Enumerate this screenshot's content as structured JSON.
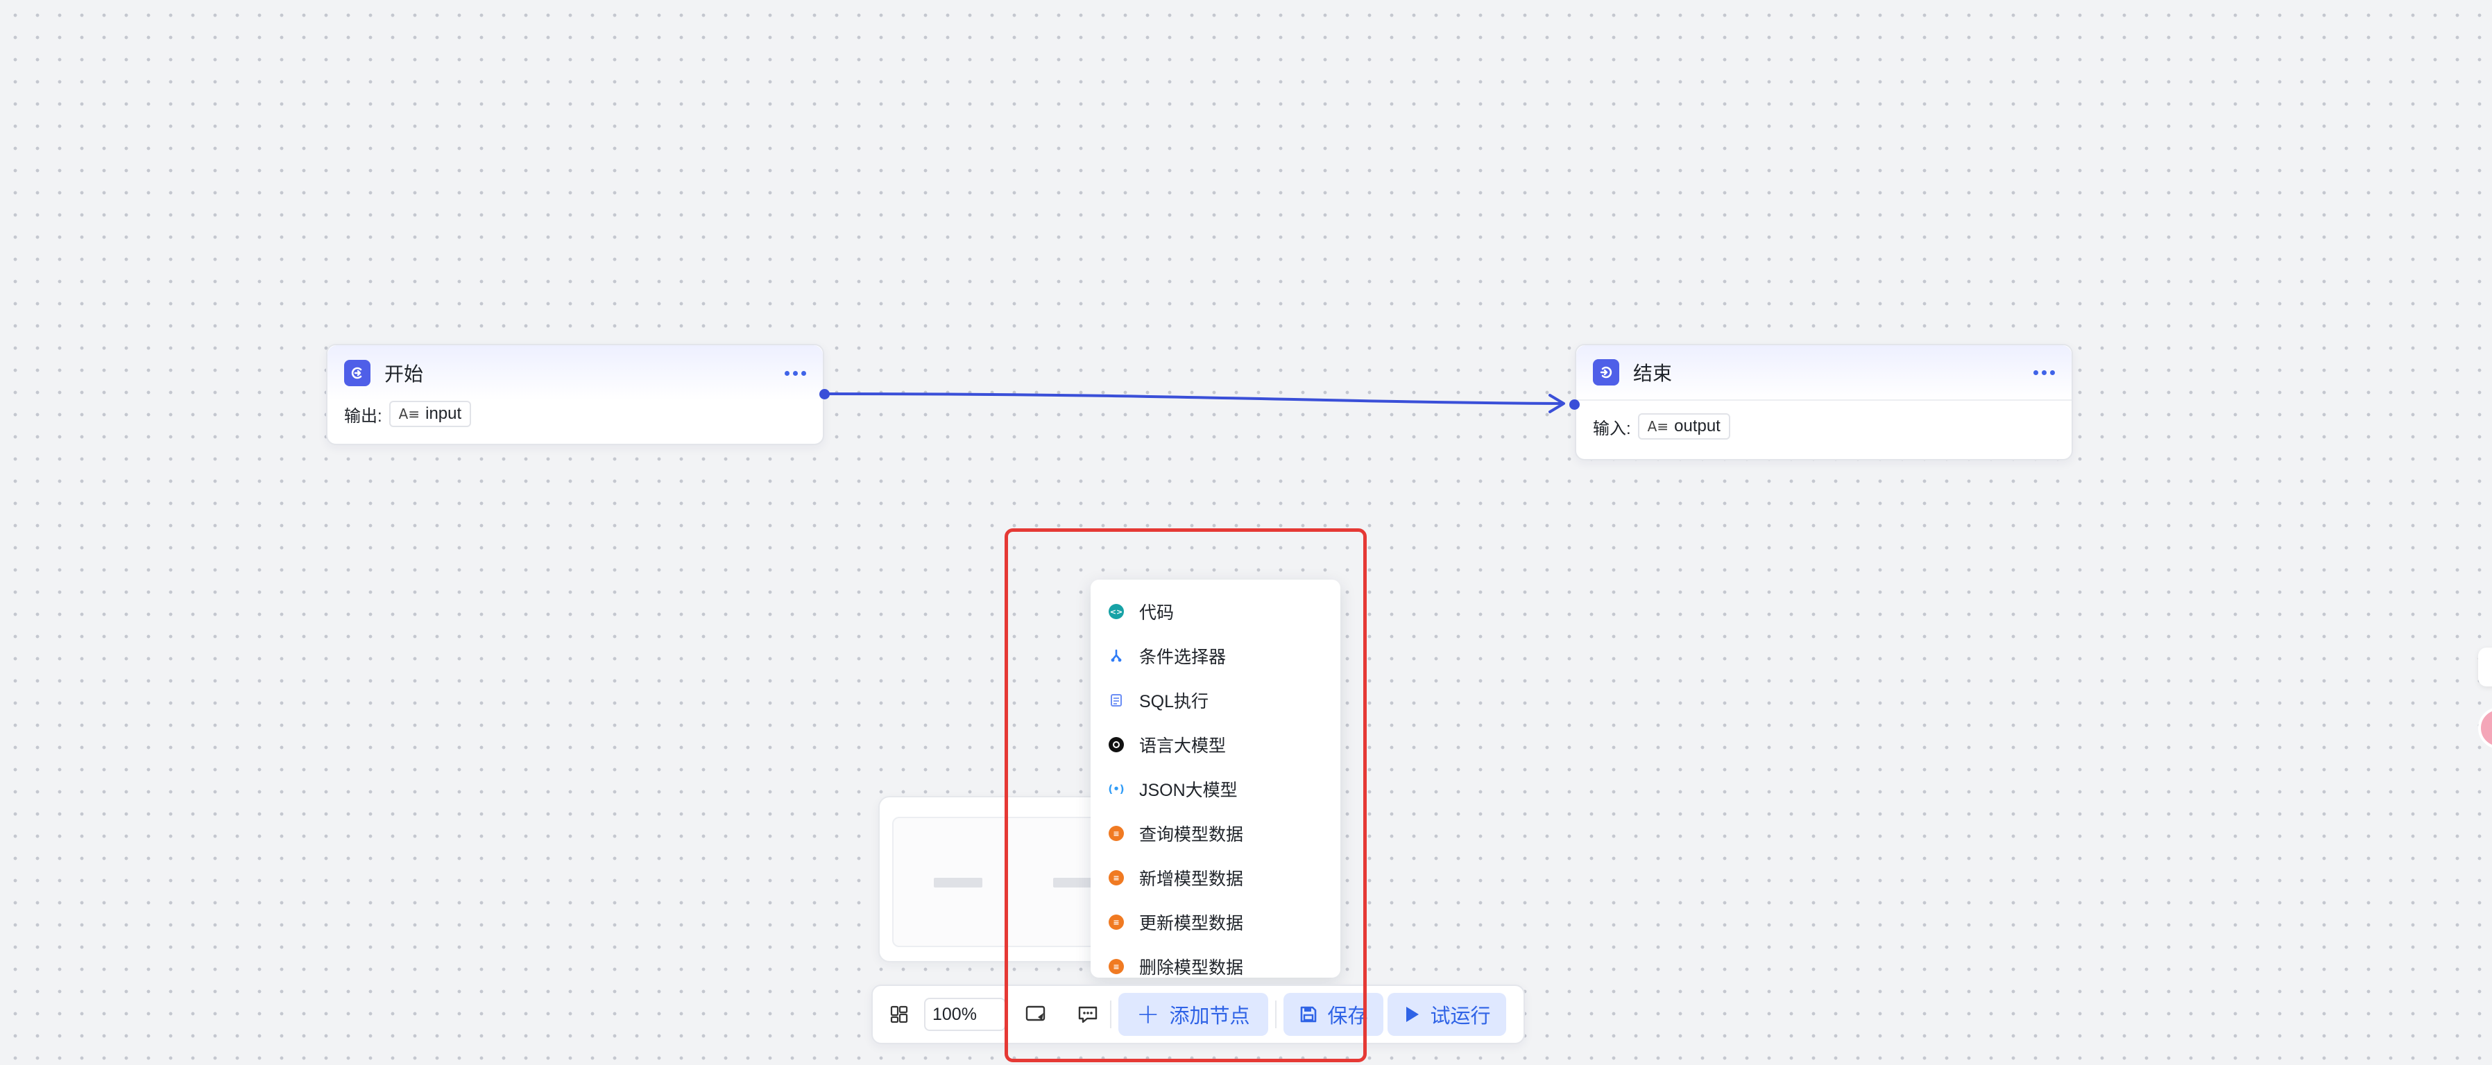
{
  "nodes": {
    "start": {
      "title": "开始",
      "field_label": "输出:",
      "variable": "input",
      "variable_icon": "text-type-icon"
    },
    "end": {
      "title": "结束",
      "field_label": "输入:",
      "variable": "output",
      "variable_icon": "text-type-icon"
    }
  },
  "menu": {
    "items": [
      {
        "label": "代码",
        "icon": "code-icon",
        "color": "#17a2a6"
      },
      {
        "label": "条件选择器",
        "icon": "branch-icon",
        "color": "#2f7cf6"
      },
      {
        "label": "SQL执行",
        "icon": "database-icon",
        "color": "#6b8ef5"
      },
      {
        "label": "语言大模型",
        "icon": "llm-icon",
        "color": "#111111"
      },
      {
        "label": "JSON大模型",
        "icon": "json-icon",
        "color": "#2f9bf6"
      },
      {
        "label": "查询模型数据",
        "icon": "model-data-icon",
        "color": "#f07a22"
      },
      {
        "label": "新增模型数据",
        "icon": "model-data-icon",
        "color": "#f07a22"
      },
      {
        "label": "更新模型数据",
        "icon": "model-data-icon",
        "color": "#f07a22"
      },
      {
        "label": "删除模型数据",
        "icon": "model-data-icon",
        "color": "#f07a22"
      }
    ]
  },
  "toolbar": {
    "zoom": "100%",
    "add_node_label": "添加节点",
    "save_label": "保存",
    "run_label": "试运行"
  },
  "colors": {
    "accent": "#3a4fd8",
    "highlight": "#e53935"
  }
}
